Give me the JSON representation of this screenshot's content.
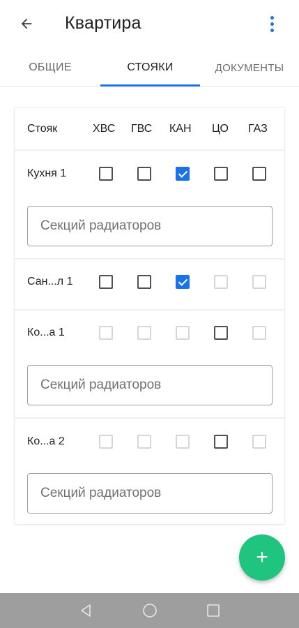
{
  "appbar": {
    "title": "Квартира",
    "back_icon": "arrow-back-icon",
    "menu_icon": "more-vert-icon",
    "accent_color": "#1a73e8"
  },
  "tabs": [
    {
      "label": "ОБЩИЕ",
      "active": false
    },
    {
      "label": "СТОЯКИ",
      "active": true
    },
    {
      "label": "ДОКУМЕНТЫ",
      "active": false
    }
  ],
  "table": {
    "header": {
      "riser": "Стояк",
      "columns": [
        "ХВС",
        "ГВС",
        "КАН",
        "ЦО",
        "ГАЗ"
      ]
    },
    "rows": [
      {
        "label": "Кухня 1",
        "checks": [
          "unchecked",
          "unchecked",
          "checked",
          "unchecked",
          "unchecked"
        ],
        "field_placeholder": "Секций радиаторов"
      },
      {
        "label": "Сан...л 1",
        "checks": [
          "unchecked",
          "unchecked",
          "checked",
          "disabled",
          "disabled"
        ],
        "field_placeholder": null
      },
      {
        "label": "Ко...а 1",
        "checks": [
          "disabled",
          "disabled",
          "disabled",
          "unchecked",
          "disabled"
        ],
        "field_placeholder": "Секций радиаторов"
      },
      {
        "label": "Ко...а 2",
        "checks": [
          "disabled",
          "disabled",
          "disabled",
          "unchecked",
          "disabled"
        ],
        "field_placeholder": "Секций радиаторов"
      }
    ]
  },
  "fab": {
    "icon": "plus-icon",
    "symbol": "+",
    "color": "#1fc47e"
  },
  "system_nav": {
    "icons": [
      "back-triangle-icon",
      "home-circle-icon",
      "recents-square-icon"
    ]
  }
}
